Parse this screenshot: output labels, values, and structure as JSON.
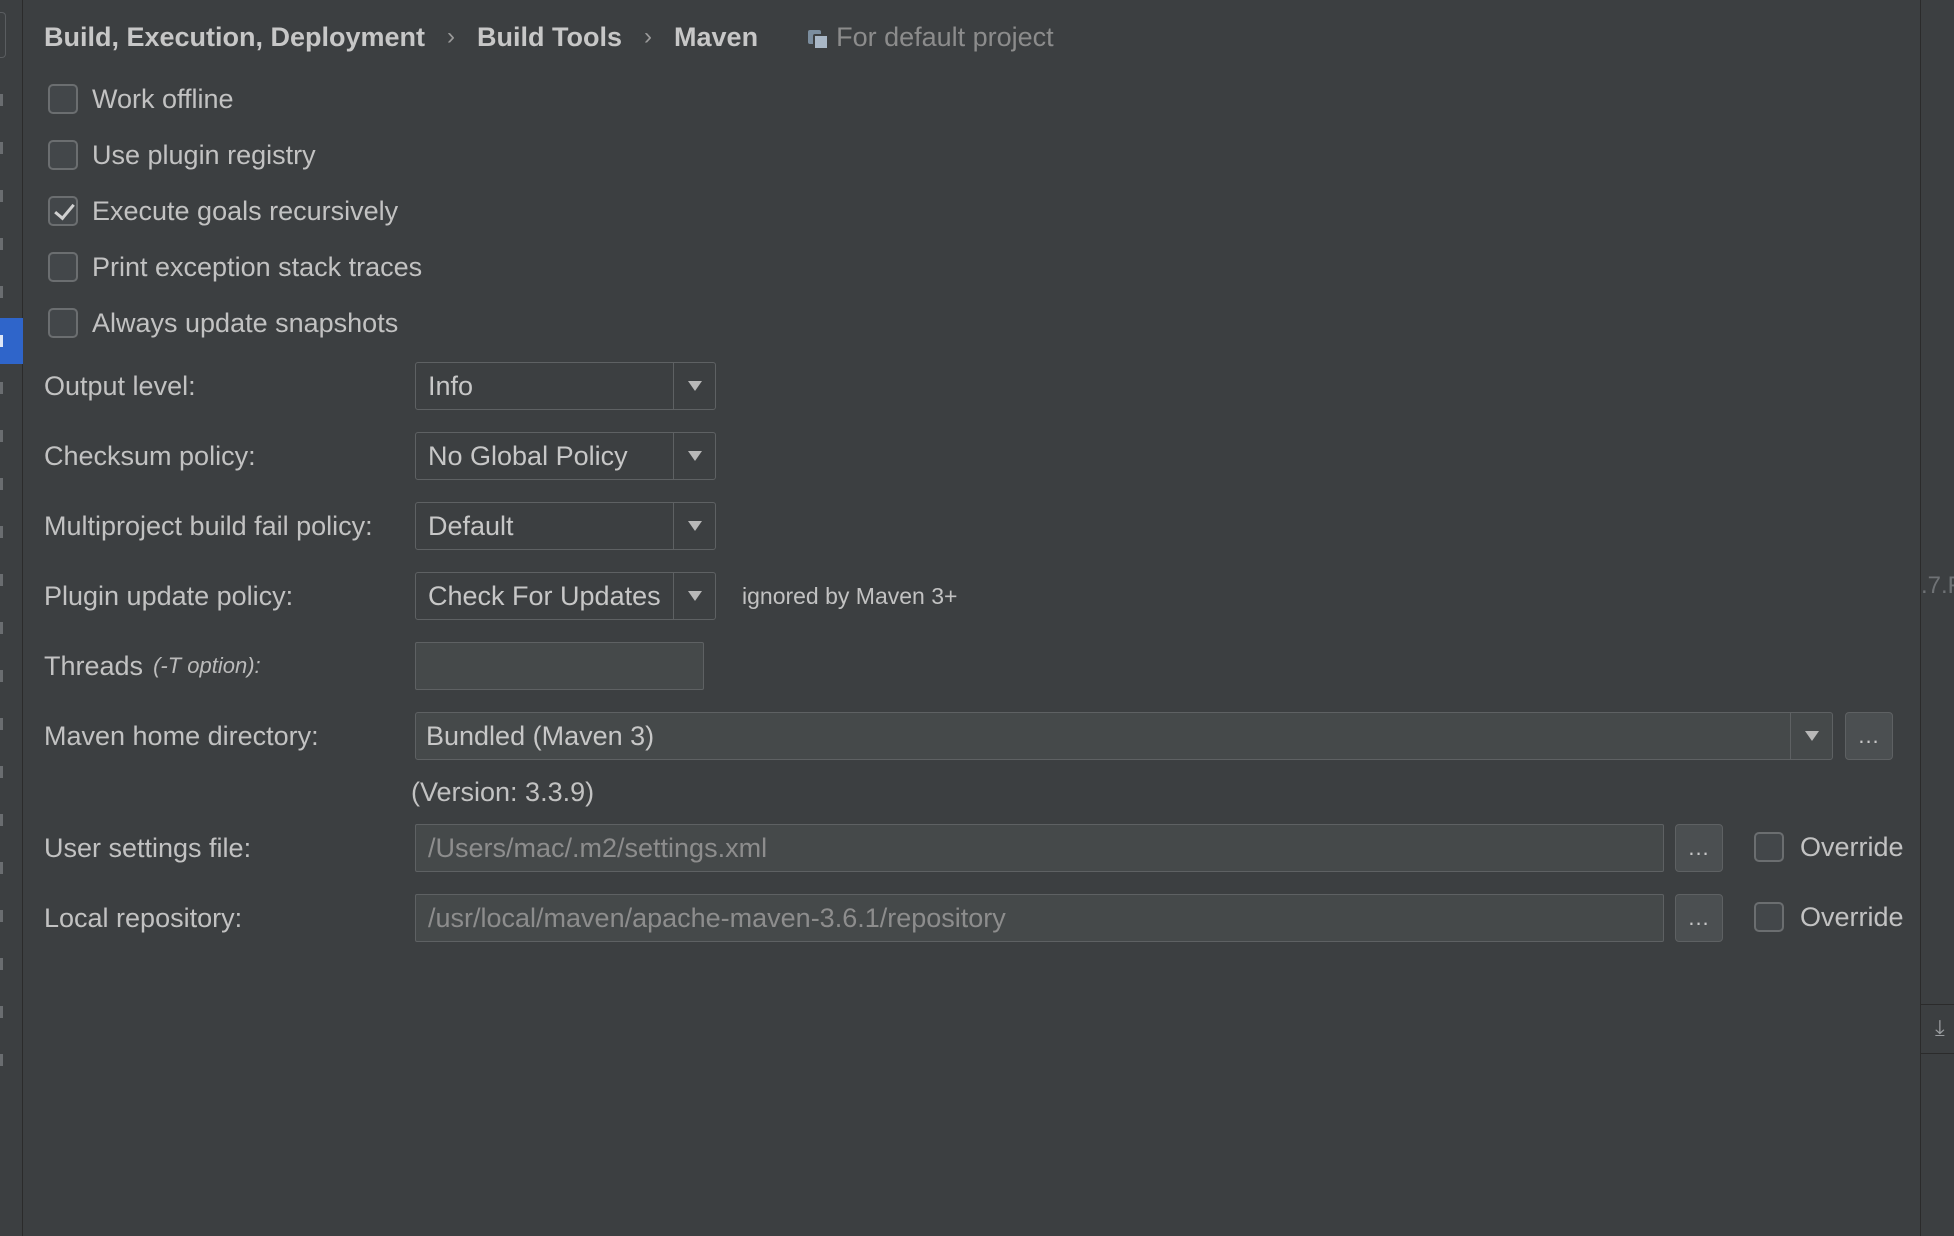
{
  "breadcrumb": {
    "items": [
      "Build, Execution, Deployment",
      "Build Tools",
      "Maven"
    ],
    "separator": "›",
    "scope": "For default project"
  },
  "checkboxes": [
    {
      "label": "Work offline",
      "checked": false
    },
    {
      "label": "Use plugin registry",
      "checked": false
    },
    {
      "label": "Execute goals recursively",
      "checked": true
    },
    {
      "label": "Print exception stack traces",
      "checked": false
    },
    {
      "label": "Always update snapshots",
      "checked": false
    }
  ],
  "form": {
    "output_level": {
      "label": "Output level:",
      "value": "Info"
    },
    "checksum_policy": {
      "label": "Checksum policy:",
      "value": "No Global Policy"
    },
    "multiproject_policy": {
      "label": "Multiproject build fail policy:",
      "value": "Default"
    },
    "plugin_update_policy": {
      "label": "Plugin update policy:",
      "value": "Check For Updates",
      "note": "ignored by Maven 3+"
    },
    "threads": {
      "label": "Threads",
      "hint": "(-T option):",
      "value": ""
    },
    "maven_home": {
      "label": "Maven home directory:",
      "value": "Bundled (Maven 3)",
      "browse": "...",
      "version": "(Version: 3.3.9)"
    },
    "user_settings": {
      "label": "User settings file:",
      "value": "/Users/mac/.m2/settings.xml",
      "browse": "...",
      "override_label": "Override",
      "override_checked": false
    },
    "local_repo": {
      "label": "Local repository:",
      "value": "/usr/local/maven/apache-maven-3.6.1/repository",
      "browse": "...",
      "override_label": "Override",
      "override_checked": false
    }
  },
  "right_strip": {
    "cut_text": ".7.F",
    "tool_icon": "download-icon"
  },
  "colors": {
    "background": "#3c3f41",
    "selection": "#2f65ca",
    "text": "#c2c2c2",
    "muted": "#8c8c8c"
  }
}
